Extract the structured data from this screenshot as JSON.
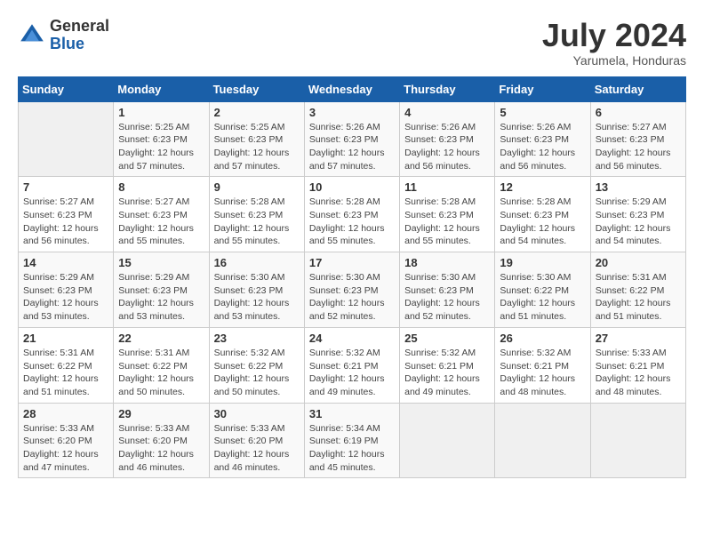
{
  "header": {
    "logo_general": "General",
    "logo_blue": "Blue",
    "month": "July 2024",
    "location": "Yarumela, Honduras"
  },
  "weekdays": [
    "Sunday",
    "Monday",
    "Tuesday",
    "Wednesday",
    "Thursday",
    "Friday",
    "Saturday"
  ],
  "weeks": [
    [
      {
        "day": "",
        "info": ""
      },
      {
        "day": "1",
        "info": "Sunrise: 5:25 AM\nSunset: 6:23 PM\nDaylight: 12 hours\nand 57 minutes."
      },
      {
        "day": "2",
        "info": "Sunrise: 5:25 AM\nSunset: 6:23 PM\nDaylight: 12 hours\nand 57 minutes."
      },
      {
        "day": "3",
        "info": "Sunrise: 5:26 AM\nSunset: 6:23 PM\nDaylight: 12 hours\nand 57 minutes."
      },
      {
        "day": "4",
        "info": "Sunrise: 5:26 AM\nSunset: 6:23 PM\nDaylight: 12 hours\nand 56 minutes."
      },
      {
        "day": "5",
        "info": "Sunrise: 5:26 AM\nSunset: 6:23 PM\nDaylight: 12 hours\nand 56 minutes."
      },
      {
        "day": "6",
        "info": "Sunrise: 5:27 AM\nSunset: 6:23 PM\nDaylight: 12 hours\nand 56 minutes."
      }
    ],
    [
      {
        "day": "7",
        "info": "Sunrise: 5:27 AM\nSunset: 6:23 PM\nDaylight: 12 hours\nand 56 minutes."
      },
      {
        "day": "8",
        "info": "Sunrise: 5:27 AM\nSunset: 6:23 PM\nDaylight: 12 hours\nand 55 minutes."
      },
      {
        "day": "9",
        "info": "Sunrise: 5:28 AM\nSunset: 6:23 PM\nDaylight: 12 hours\nand 55 minutes."
      },
      {
        "day": "10",
        "info": "Sunrise: 5:28 AM\nSunset: 6:23 PM\nDaylight: 12 hours\nand 55 minutes."
      },
      {
        "day": "11",
        "info": "Sunrise: 5:28 AM\nSunset: 6:23 PM\nDaylight: 12 hours\nand 55 minutes."
      },
      {
        "day": "12",
        "info": "Sunrise: 5:28 AM\nSunset: 6:23 PM\nDaylight: 12 hours\nand 54 minutes."
      },
      {
        "day": "13",
        "info": "Sunrise: 5:29 AM\nSunset: 6:23 PM\nDaylight: 12 hours\nand 54 minutes."
      }
    ],
    [
      {
        "day": "14",
        "info": "Sunrise: 5:29 AM\nSunset: 6:23 PM\nDaylight: 12 hours\nand 53 minutes."
      },
      {
        "day": "15",
        "info": "Sunrise: 5:29 AM\nSunset: 6:23 PM\nDaylight: 12 hours\nand 53 minutes."
      },
      {
        "day": "16",
        "info": "Sunrise: 5:30 AM\nSunset: 6:23 PM\nDaylight: 12 hours\nand 53 minutes."
      },
      {
        "day": "17",
        "info": "Sunrise: 5:30 AM\nSunset: 6:23 PM\nDaylight: 12 hours\nand 52 minutes."
      },
      {
        "day": "18",
        "info": "Sunrise: 5:30 AM\nSunset: 6:23 PM\nDaylight: 12 hours\nand 52 minutes."
      },
      {
        "day": "19",
        "info": "Sunrise: 5:30 AM\nSunset: 6:22 PM\nDaylight: 12 hours\nand 51 minutes."
      },
      {
        "day": "20",
        "info": "Sunrise: 5:31 AM\nSunset: 6:22 PM\nDaylight: 12 hours\nand 51 minutes."
      }
    ],
    [
      {
        "day": "21",
        "info": "Sunrise: 5:31 AM\nSunset: 6:22 PM\nDaylight: 12 hours\nand 51 minutes."
      },
      {
        "day": "22",
        "info": "Sunrise: 5:31 AM\nSunset: 6:22 PM\nDaylight: 12 hours\nand 50 minutes."
      },
      {
        "day": "23",
        "info": "Sunrise: 5:32 AM\nSunset: 6:22 PM\nDaylight: 12 hours\nand 50 minutes."
      },
      {
        "day": "24",
        "info": "Sunrise: 5:32 AM\nSunset: 6:21 PM\nDaylight: 12 hours\nand 49 minutes."
      },
      {
        "day": "25",
        "info": "Sunrise: 5:32 AM\nSunset: 6:21 PM\nDaylight: 12 hours\nand 49 minutes."
      },
      {
        "day": "26",
        "info": "Sunrise: 5:32 AM\nSunset: 6:21 PM\nDaylight: 12 hours\nand 48 minutes."
      },
      {
        "day": "27",
        "info": "Sunrise: 5:33 AM\nSunset: 6:21 PM\nDaylight: 12 hours\nand 48 minutes."
      }
    ],
    [
      {
        "day": "28",
        "info": "Sunrise: 5:33 AM\nSunset: 6:20 PM\nDaylight: 12 hours\nand 47 minutes."
      },
      {
        "day": "29",
        "info": "Sunrise: 5:33 AM\nSunset: 6:20 PM\nDaylight: 12 hours\nand 46 minutes."
      },
      {
        "day": "30",
        "info": "Sunrise: 5:33 AM\nSunset: 6:20 PM\nDaylight: 12 hours\nand 46 minutes."
      },
      {
        "day": "31",
        "info": "Sunrise: 5:34 AM\nSunset: 6:19 PM\nDaylight: 12 hours\nand 45 minutes."
      },
      {
        "day": "",
        "info": ""
      },
      {
        "day": "",
        "info": ""
      },
      {
        "day": "",
        "info": ""
      }
    ]
  ]
}
